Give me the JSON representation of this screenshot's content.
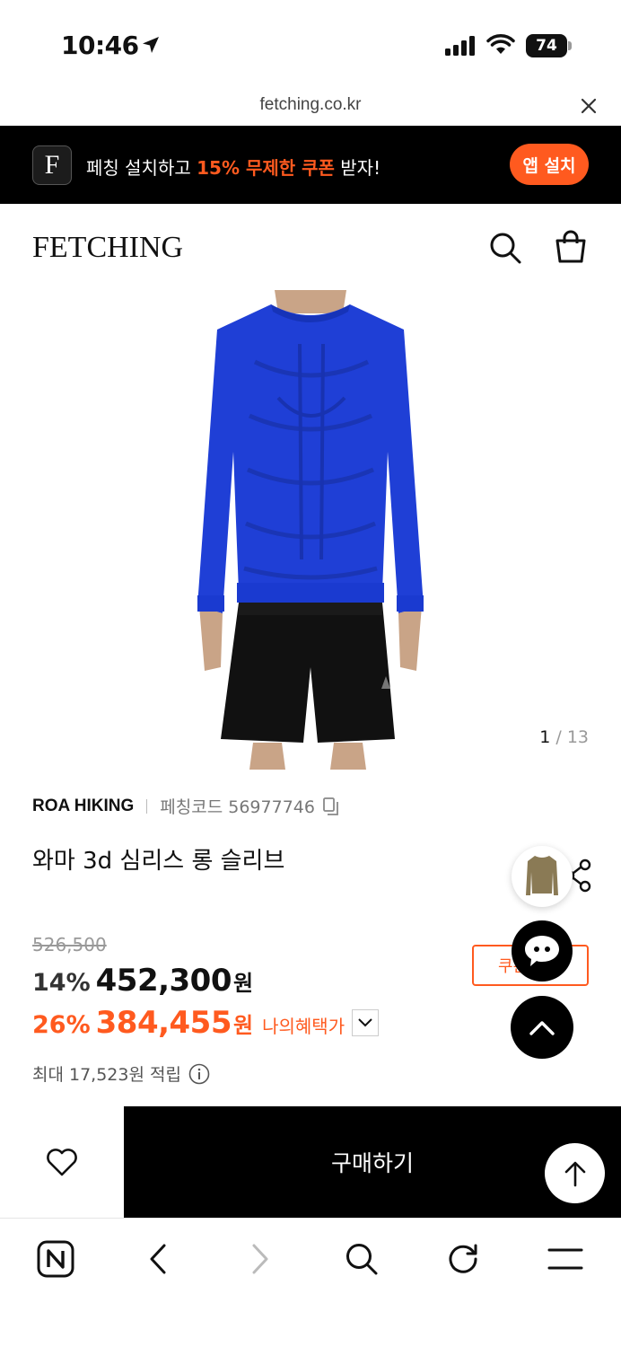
{
  "status_bar": {
    "time": "10:46",
    "battery": "74"
  },
  "browser": {
    "url": "fetching.co.kr"
  },
  "promo": {
    "logo_letter": "F",
    "text_before": "페칭 설치하고 ",
    "text_highlight": "15% 무제한 쿠폰",
    "text_after": " 받자!",
    "button_label": "앱 설치",
    "accent_color": "#ff5a1f"
  },
  "header": {
    "brand": "FETCHING"
  },
  "gallery": {
    "current": "1",
    "separator": " / ",
    "total": "13"
  },
  "product": {
    "brand": "ROA HIKING",
    "code_label": "페칭코드 56977746",
    "title": "와마 3d 심리스 롱 슬리브",
    "original_price": "526,500",
    "discount_rate": "14%",
    "sale_price": "452,300",
    "currency": "원",
    "benefit_rate": "26%",
    "benefit_price": "384,455",
    "benefit_label": "나의혜택가",
    "points": "최대 17,523원 적립",
    "coupon_button": "쿠폰 받기"
  },
  "purchase": {
    "buy_label": "구매하기"
  }
}
